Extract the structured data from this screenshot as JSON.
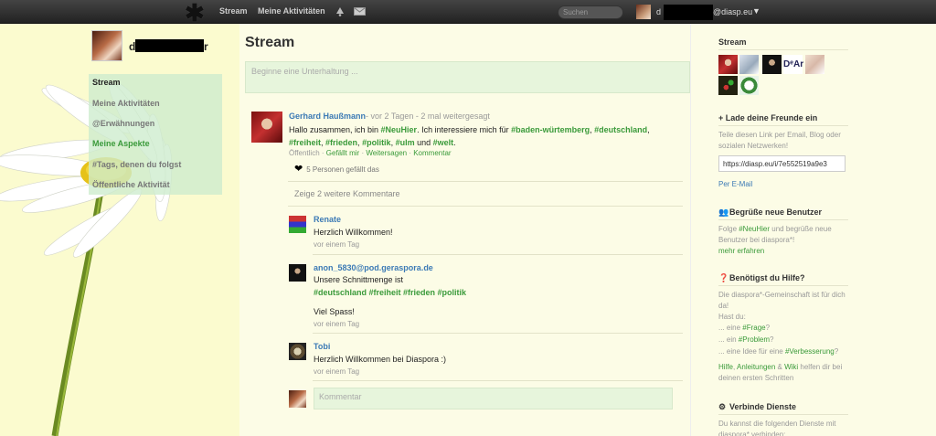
{
  "topbar": {
    "nav_stream": "Stream",
    "nav_activity": "Meine Aktivitäten",
    "search_placeholder": "Suchen",
    "user_name_start": "d",
    "user_domain": "@diasp.eu",
    "user_caret": "▼"
  },
  "profile": {
    "name_start": "d",
    "name_end": "r"
  },
  "sidebar": {
    "items": [
      {
        "label": "Stream"
      },
      {
        "label": "Meine Aktivitäten"
      },
      {
        "label": "@Erwähnungen"
      },
      {
        "label": "Meine Aspekte"
      },
      {
        "label": "#Tags, denen du folgst"
      },
      {
        "label": "Öffentliche Aktivität"
      }
    ]
  },
  "main": {
    "title": "Stream",
    "composer_placeholder": "Beginne eine Unterhaltung ...",
    "post": {
      "author": "Gerhard Haußmann",
      "meta": "- vor 2 Tagen - 2 mal weitergesagt",
      "text_1": "Hallo zusammen, ich bin ",
      "tag_neuhier": "#NeuHier",
      "text_2": ". Ich interessiere mich für ",
      "tag_bw": "#baden-würtemberg",
      "sep1": ", ",
      "tag_deutschland": "#deutschland",
      "sep2": ",",
      "tag_freiheit": "#freiheit",
      "sep3": ", ",
      "tag_frieden": "#frieden",
      "sep4": ", ",
      "tag_politik": "#politik",
      "sep5": ", ",
      "tag_ulm": "#ulm",
      "text_3": " und ",
      "tag_welt": "#welt",
      "text_4": ".",
      "visibility": "Öffentlich",
      "action_like": "Gefällt mir",
      "action_reshare": "Weitersagen",
      "action_comment": "Kommentar",
      "dot": " · ",
      "likes": "5 Personen gefällt das"
    },
    "more_comments": "Zeige 2 weitere Kommentare",
    "comments": [
      {
        "author": "Renate",
        "text": "Herzlich Willkommen!",
        "time": "vor einem Tag"
      },
      {
        "author": "anon_5830@pod.geraspora.de",
        "text": "Unsere Schnittmenge ist",
        "tags": "#deutschland #freiheit #frieden #politik",
        "text2": "Viel Spass!",
        "time": "vor einem Tag"
      },
      {
        "author": "Tobi",
        "text": "Herzlich Willkommen bei Diaspora :)",
        "time": "vor einem Tag"
      }
    ],
    "comment_placeholder": "Kommentar"
  },
  "right": {
    "stream_title": "Stream",
    "invite_title": "+ Lade deine Freunde ein",
    "invite_text": "Teile diesen Link per Email, Blog oder sozialen Netzwerken!",
    "invite_url": "https://diasp.eu/i/7e552519a9e3",
    "invite_email": "Per E-Mail",
    "welcome_title": "Begrüße neue Benutzer",
    "welcome_text_1": "Folge ",
    "welcome_tag": "#NeuHier",
    "welcome_text_2": " und begrüße neue Benutzer bei diaspora*!",
    "welcome_more": "mehr erfahren",
    "help_title": "Benötigst du Hilfe?",
    "help_text": "Die diaspora*-Gemeinschaft ist für dich da!",
    "help_hast": "Hast du:",
    "help_q1_pre": "... eine ",
    "help_q1_tag": "#Frage",
    "help_q1_post": "?",
    "help_q2_pre": "... ein ",
    "help_q2_tag": "#Problem",
    "help_q2_post": "?",
    "help_q3_pre": "... eine Idee für eine ",
    "help_q3_tag": "#Verbesserung",
    "help_q3_post": "?",
    "help_links_1": "Hilfe",
    "help_links_sep1": ", ",
    "help_links_2": "Anleitungen",
    "help_links_sep2": " & ",
    "help_links_3": "Wiki",
    "help_links_text": " helfen dir bei deinen ersten Schritten",
    "services_title": "Verbinde Dienste",
    "services_text": "Du kannst die folgenden Dienste mit diaspora* verbinden:",
    "thumb_dar_text": "DᵉAr"
  },
  "colors": {
    "background": "#fbfbcf",
    "link_blue": "#3c7ab5",
    "tag_green": "#3a9a3a",
    "sidebar_highlight": "#cdeccd"
  }
}
